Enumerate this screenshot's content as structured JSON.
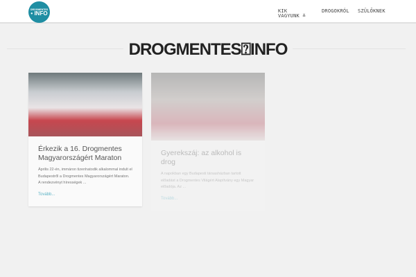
{
  "logo": {
    "small": "DROGMENTES",
    "big": "• INFO"
  },
  "nav": [
    {
      "label_1": "KIK",
      "label_2": "VAGYUNK ≚"
    },
    {
      "label": "DROGOKRÓL"
    },
    {
      "label": "SZÜLŐKNEK"
    }
  ],
  "page_title": "DROGMENTES⍰INFO",
  "posts": [
    {
      "title": "Érkezik a 16. Drogmentes Magyarországért Maraton",
      "excerpt": "Április 22-én, immáron tizenhatodik alkalommal indult el Budapestről a Drogmentes Magyarországért Maraton. A rendezvényt hírességek ...",
      "more": "Tovább..."
    },
    {
      "title": "Gyerekszáj: az alkohol is drog",
      "excerpt": "A napokban egy Budapesti társasházban tartott előadást a Drogmentes Világért Alapítvány egy Magyar előadója. Az ...",
      "more": "Tovább..."
    }
  ]
}
